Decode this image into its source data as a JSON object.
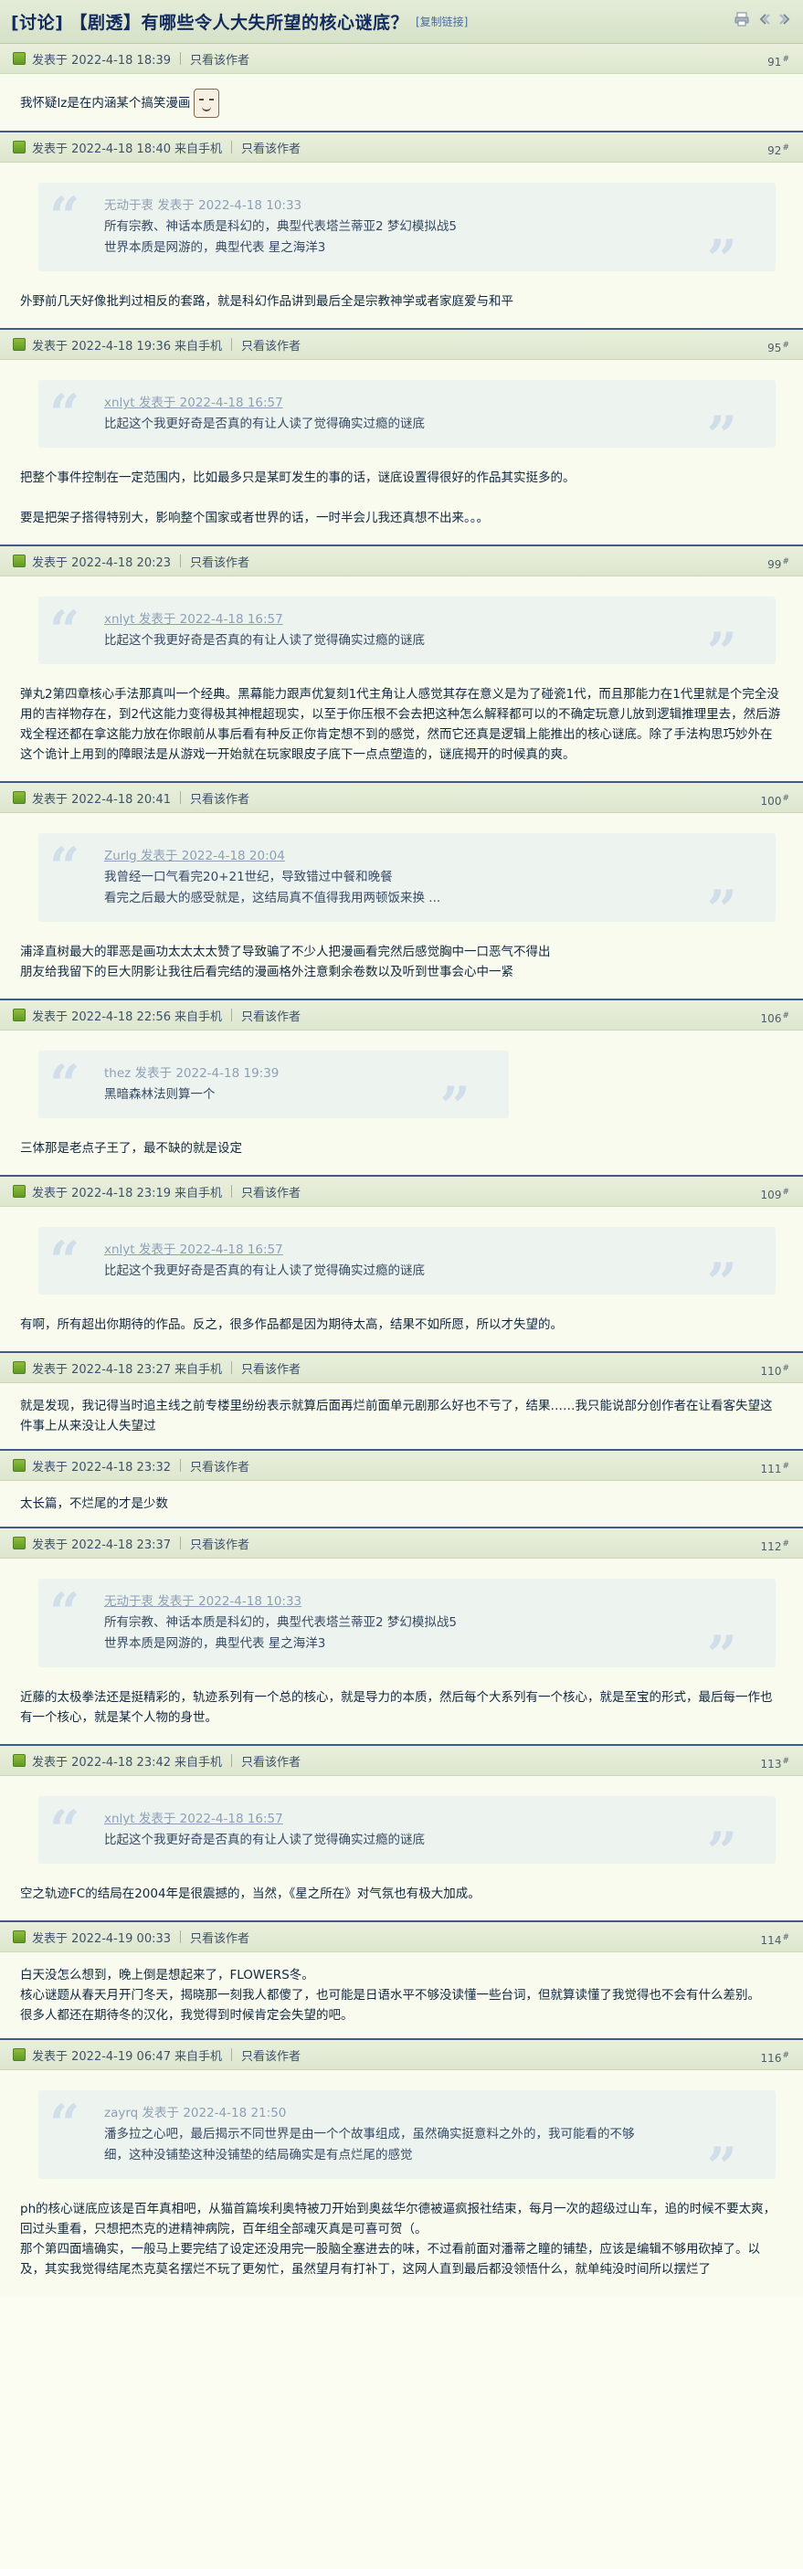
{
  "header": {
    "title": "[讨论] 【剧透】有哪些令人大失所望的核心谜底？",
    "copy_link": "[复制链接]"
  },
  "labels": {
    "mobile": "来自手机",
    "only_author": "只看该作者"
  },
  "posts": [
    {
      "meta": "发表于 2022-4-18 18:39",
      "floor": "91",
      "body1": "我怀疑lz是在内涵某个搞笑漫画"
    },
    {
      "meta": "发表于 2022-4-18 18:40",
      "floor": "92",
      "quote_author": "无动于衷 发表于 2022-4-18 10:33",
      "quote_line1": "所有宗教、神话本质是科幻的，典型代表塔兰蒂亚2 梦幻模拟战5",
      "quote_line2": "世界本质是网游的，典型代表 星之海洋3",
      "body1": "外野前几天好像批判过相反的套路，就是科幻作品讲到最后全是宗教神学或者家庭爱与和平"
    },
    {
      "meta": "发表于 2022-4-18 19:36",
      "floor": "95",
      "quote_author": "xnlyt 发表于 2022-4-18 16:57",
      "quote_line1": "比起这个我更好奇是否真的有让人读了觉得确实过瘾的谜底",
      "body1": "把整个事件控制在一定范围内，比如最多只是某町发生的事的话，谜底设置得很好的作品其实挺多的。",
      "body2": "要是把架子搭得特别大，影响整个国家或者世界的话，一时半会儿我还真想不出来。。。"
    },
    {
      "meta": "发表于 2022-4-18 20:23",
      "floor": "99",
      "quote_author": "xnlyt 发表于 2022-4-18 16:57",
      "quote_line1": "比起这个我更好奇是否真的有让人读了觉得确实过瘾的谜底",
      "body1": "弹丸2第四章核心手法那真叫一个经典。黑幕能力跟声优复刻1代主角让人感觉其存在意义是为了碰瓷1代，而且那能力在1代里就是个完全没用的吉祥物存在，到2代这能力变得极其神棍超现实，以至于你压根不会去把这种怎么解释都可以的不确定玩意儿放到逻辑推理里去，然后游戏全程还都在拿这能力放在你眼前从事后看有种反正你肯定想不到的感觉，然而它还真是逻辑上能推出的核心谜底。除了手法构思巧妙外在这个诡计上用到的障眼法是从游戏一开始就在玩家眼皮子底下一点点塑造的，谜底揭开的时候真的爽。"
    },
    {
      "meta": "发表于 2022-4-18 20:41",
      "floor": "100",
      "quote_author": "Zurlg 发表于 2022-4-18 20:04",
      "quote_line1": "我曾经一口气看完20+21世纪，导致错过中餐和晚餐",
      "quote_line2": "看完之后最大的感受就是，这结局真不值得我用两顿饭来换 ...",
      "body1": "浦泽直树最大的罪恶是画功太太太太赞了导致骗了不少人把漫画看完然后感觉胸中一口恶气不得出",
      "body2": "朋友给我留下的巨大阴影让我往后看完结的漫画格外注意剩余卷数以及听到世事会心中一紧"
    },
    {
      "meta": "发表于 2022-4-18 22:56",
      "floor": "106",
      "quote_author": "thez 发表于 2022-4-18 19:39",
      "quote_line1": "黑暗森林法则算一个",
      "body1": "三体那是老点子王了，最不缺的就是设定"
    },
    {
      "meta": "发表于 2022-4-18 23:19",
      "floor": "109",
      "quote_author": "xnlyt 发表于 2022-4-18 16:57",
      "quote_line1": "比起这个我更好奇是否真的有让人读了觉得确实过瘾的谜底",
      "body1": "有啊，所有超出你期待的作品。反之，很多作品都是因为期待太高，结果不如所愿，所以才失望的。"
    },
    {
      "meta": "发表于 2022-4-18 23:27",
      "floor": "110",
      "body1": "就是发现，我记得当时追主线之前专楼里纷纷表示就算后面再烂前面单元剧那么好也不亏了，结果……我只能说部分创作者在让看客失望这件事上从来没让人失望过"
    },
    {
      "meta": "发表于 2022-4-18 23:32",
      "floor": "111",
      "body1": "太长篇，不烂尾的才是少数"
    },
    {
      "meta": "发表于 2022-4-18 23:37",
      "floor": "112",
      "quote_author": "无动于衷 发表于 2022-4-18 10:33",
      "quote_line1": "所有宗教、神话本质是科幻的，典型代表塔兰蒂亚2 梦幻模拟战5",
      "quote_line2": "世界本质是网游的，典型代表 星之海洋3",
      "body1": "近藤的太极拳法还是挺精彩的，轨迹系列有一个总的核心，就是导力的本质，然后每个大系列有一个核心，就是至宝的形式，最后每一作也有一个核心，就是某个人物的身世。"
    },
    {
      "meta": "发表于 2022-4-18 23:42",
      "floor": "113",
      "quote_author": "xnlyt 发表于 2022-4-18 16:57",
      "quote_line1": "比起这个我更好奇是否真的有让人读了觉得确实过瘾的谜底",
      "body1": "空之轨迹FC的结局在2004年是很震撼的，当然，《星之所在》对气氛也有极大加成。"
    },
    {
      "meta": "发表于 2022-4-19 00:33",
      "floor": "114",
      "body1": "白天没怎么想到，晚上倒是想起来了，FLOWERS冬。",
      "body2": "核心谜题从春天月开门冬天，揭晓那一刻我人都傻了，也可能是日语水平不够没读懂一些台词，但就算读懂了我觉得也不会有什么差别。",
      "body3": "很多人都还在期待冬的汉化，我觉得到时候肯定会失望的吧。"
    },
    {
      "meta": "发表于 2022-4-19 06:47",
      "floor": "116",
      "quote_author": "zayrq 发表于 2022-4-18 21:50",
      "quote_line1": "潘多拉之心吧，最后揭示不同世界是由一个个故事组成，虽然确实挺意料之外的，我可能看的不够",
      "quote_line2": "细，这种没铺垫这种没铺垫的结局确实是有点烂尾的感觉",
      "body1": "ph的核心谜底应该是百年真相吧，从猫首篇埃利奥特被刀开始到奥兹华尔德被逼疯报社结束，每月一次的超级过山车，追的时候不要太爽，回过头重看，只想把杰克的进精神病院，百年组全部魂灭真是可喜可贺（。",
      "body2": "那个第四面墙确实，一般马上要完结了设定还没用完一股脑全塞进去的味，不过看前面对潘蒂之瞳的铺垫，应该是编辑不够用砍掉了。以及，其实我觉得结尾杰克莫名摆烂不玩了更匆忙，虽然望月有打补丁，这网人直到最后都没领悟什么，就单纯没时间所以摆烂了"
    }
  ]
}
